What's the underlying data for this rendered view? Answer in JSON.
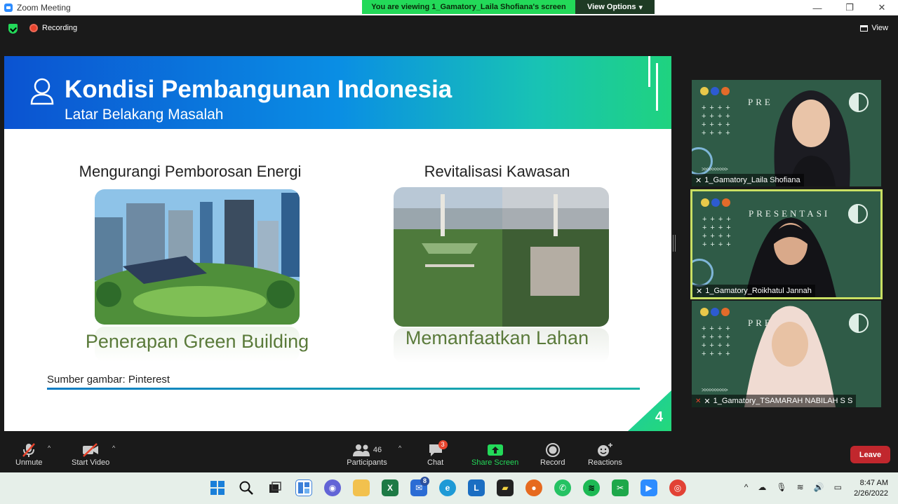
{
  "window": {
    "title": "Zoom Meeting",
    "minimize": "—",
    "restore": "❐",
    "close": "✕"
  },
  "banner": {
    "viewing": "You are viewing 1_Gamatory_Laila Shofiana's screen",
    "view_options": "View Options"
  },
  "topbar": {
    "recording": "Recording",
    "view": "View"
  },
  "slide": {
    "title": "Kondisi Pembangunan Indonesia",
    "subtitle": "Latar Belakang Masalah",
    "left_heading": "Mengurangi Pemborosan Energi",
    "left_caption": "Penerapan Green Building",
    "right_heading": "Revitalisasi Kawasan",
    "right_caption": "Memanfaatkan Lahan",
    "source": "Sumber gambar: Pinterest",
    "page_number": "4"
  },
  "participants": [
    {
      "name": "1_Gamatory_Laila Shofiana",
      "pres": "PRE",
      "active": false,
      "muted": false
    },
    {
      "name": "1_Gamatory_Roikhatul Jannah",
      "pres": "PRESENTASI",
      "active": true,
      "muted": false
    },
    {
      "name": "1_Gamatory_TSAMARAH NABILAH S S",
      "pres": "PRE",
      "active": false,
      "muted": true
    }
  ],
  "toolbar": {
    "unmute": "Unmute",
    "start_video": "Start Video",
    "participants": "Participants",
    "participants_count": "46",
    "chat": "Chat",
    "chat_badge": "3",
    "share_screen": "Share Screen",
    "record": "Record",
    "reactions": "Reactions",
    "leave": "Leave"
  },
  "taskbar": {
    "time": "8:47 AM",
    "date": "2/26/2022",
    "mail_badge": "8"
  },
  "colors": {
    "share_green": "#23d959",
    "leave_red": "#c1272d",
    "active_border": "#c9e063"
  }
}
